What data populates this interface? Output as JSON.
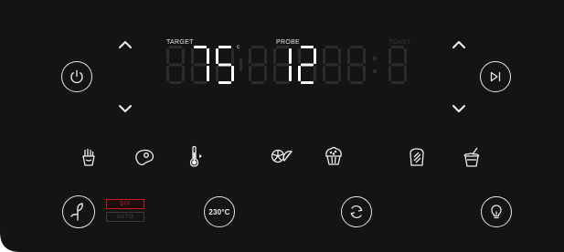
{
  "display": {
    "target_label": "TARGET",
    "probe_label": "PROBE",
    "toast_label": "TOAST",
    "unit": "c",
    "target_value": "75",
    "probe_value": "12"
  },
  "buttons": {
    "preset_temp": "230°C"
  },
  "mode": {
    "options": [
      "DIY",
      "AUTO"
    ],
    "selected": "DIY"
  },
  "cooking_modes": [
    "fries-icon",
    "steak-icon",
    "thermometer-icon",
    "citrus-icon",
    "muffin-icon",
    "toast-icon",
    "drink-icon"
  ],
  "colors": {
    "panel": "#141414",
    "segment_on": "#ffffff",
    "segment_off": "#2c2c2c",
    "accent_red": "#c8171d"
  }
}
